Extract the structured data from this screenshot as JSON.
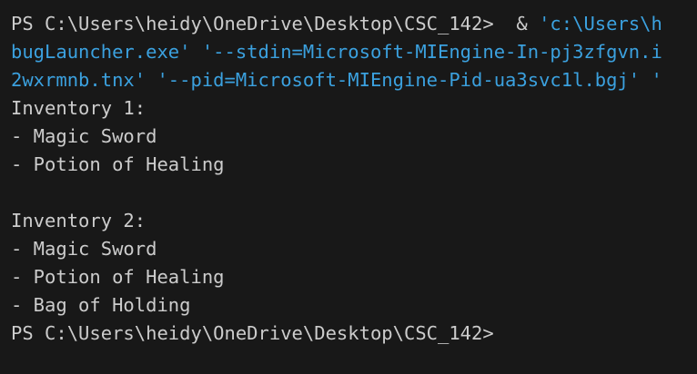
{
  "terminal": {
    "prompt_1": "PS C:\\Users\\heidy\\OneDrive\\Desktop\\CSC_142>",
    "command_amp": "  & ",
    "command_path": "'c:\\Users\\h",
    "command_line_2": "bugLauncher.exe' '--stdin=Microsoft-MIEngine-In-pj3zfgvn.i",
    "command_line_3": "2wxrmnb.tnx' '--pid=Microsoft-MIEngine-Pid-ua3svc1l.bgj' '",
    "output": [
      "Inventory 1:",
      "- Magic Sword",
      "- Potion of Healing",
      "",
      "Inventory 2:",
      "- Magic Sword",
      "- Potion of Healing",
      "- Bag of Holding"
    ],
    "prompt_2": "PS C:\\Users\\heidy\\OneDrive\\Desktop\\CSC_142>"
  },
  "colors": {
    "background": "#181818",
    "foreground": "#cccccc",
    "string": "#3ba1df"
  }
}
